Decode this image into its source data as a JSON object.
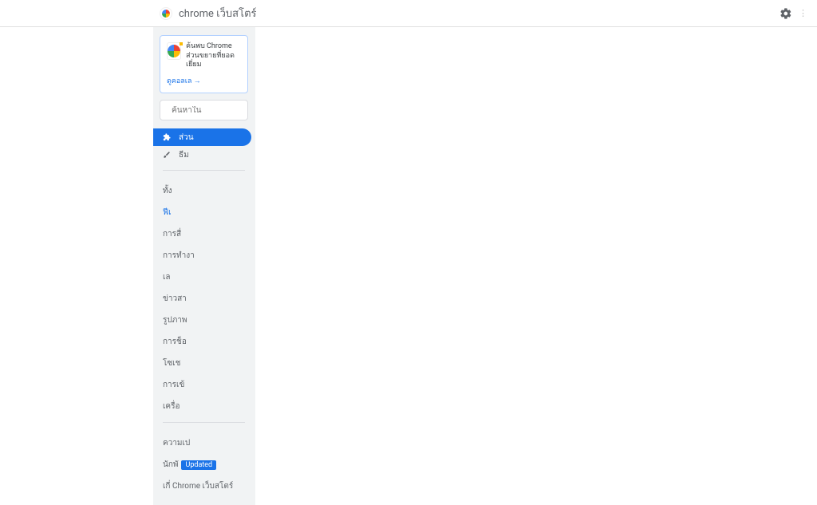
{
  "header": {
    "title": "chrome เว็บสโตร์",
    "sign_in": "⋮"
  },
  "promo": {
    "text": "ค้นพบ Chrome ส่วนขยายที่ยอดเยี่ยม",
    "link_label": "ดูคอลเล",
    "arrow": "→"
  },
  "search": {
    "placeholder": "ค้นหาใน"
  },
  "nav": {
    "ext_label": "ส่วน",
    "theme_label": "ธีม"
  },
  "categories": [
    "ทั้ง",
    "ฟีเ",
    "การสื่",
    "การทำงา",
    "เล",
    "ข่าวสา",
    "รูปภาพ",
    "การช็อ",
    "โซเช",
    "การเข้",
    "เครื่อ"
  ],
  "selected_category_index": 1,
  "footer": {
    "privacy": "ความเป",
    "developer": "นักพั",
    "developer_badge": "Updated",
    "about": "เกี่ Chrome เว็บสโตร์"
  }
}
